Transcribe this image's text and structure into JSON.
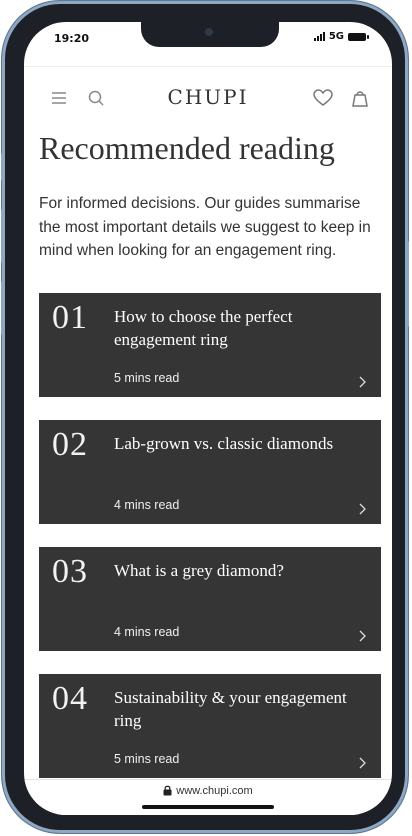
{
  "status": {
    "time": "19:20",
    "network": "5G"
  },
  "header": {
    "logo": "CHUPI",
    "icons": [
      "menu-icon",
      "search-icon",
      "heart-icon",
      "bag-icon"
    ]
  },
  "page": {
    "title": "Recommended reading",
    "intro": "For informed decisions. Our guides summarise the most important details we suggest to keep in mind when looking for an engagement ring."
  },
  "guides": [
    {
      "number": "01",
      "title": "How to choose the perfect engagement ring",
      "read_time": "5 mins read"
    },
    {
      "number": "02",
      "title": "Lab-grown vs. classic diamonds",
      "read_time": "4 mins read"
    },
    {
      "number": "03",
      "title": "What is a grey diamond?",
      "read_time": "4 mins read"
    },
    {
      "number": "04",
      "title": "Sustainability & your engagement ring",
      "read_time": "5 mins read"
    }
  ],
  "browser": {
    "url": "www.chupi.com"
  },
  "colors": {
    "card_background": "#353535",
    "text_dark": "#333333",
    "frame": "#8ea7c3"
  }
}
